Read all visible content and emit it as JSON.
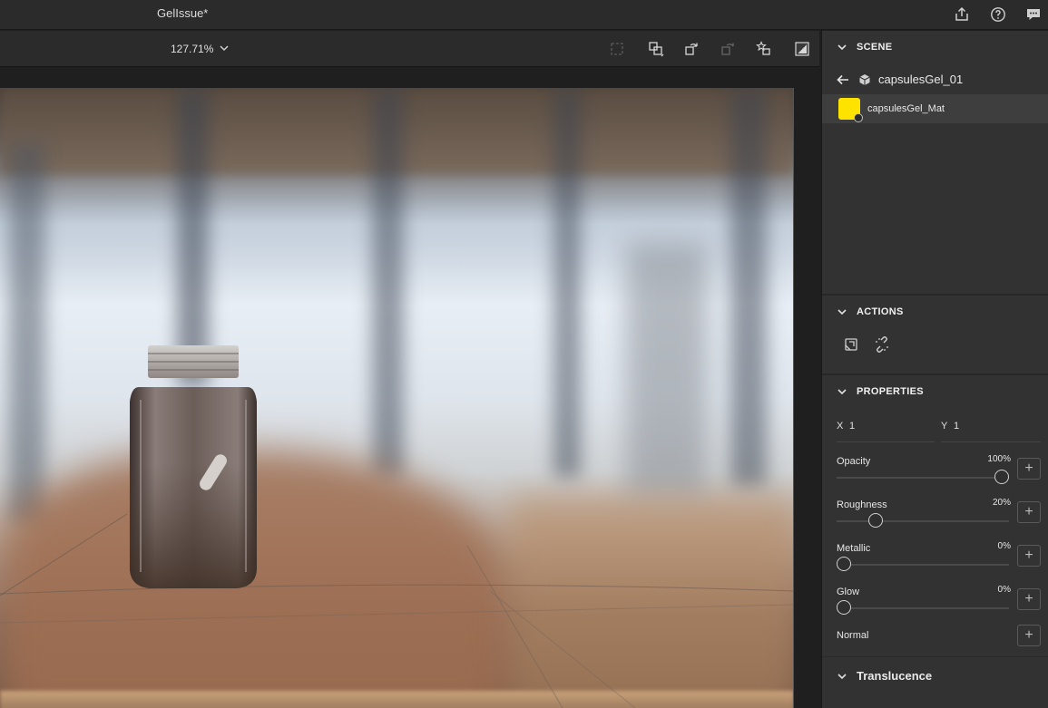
{
  "app": {
    "document_title": "GelIssue*",
    "title_icons": [
      "share-icon",
      "help-icon",
      "feedback-icon"
    ]
  },
  "viewport_toolbar": {
    "zoom": "127.71%",
    "icons": [
      "frame-icon",
      "fit-selection-icon",
      "rotate-icon",
      "redo-camera-icon",
      "favorite-camera-icon",
      "render-icon"
    ]
  },
  "scene": {
    "header": "SCENE",
    "object_name": "capsulesGel_01",
    "material_name": "capsulesGel_Mat",
    "material_color": "#ffe300"
  },
  "actions": {
    "header": "ACTIONS",
    "icons": [
      "replace-material-icon",
      "unlink-icon"
    ]
  },
  "properties": {
    "header": "PROPERTIES",
    "repeat": {
      "x_label": "X",
      "x_value": "1",
      "y_label": "Y",
      "y_value": "1"
    },
    "opacity": {
      "label": "Opacity",
      "value": "100%",
      "level": 1.0
    },
    "roughness": {
      "label": "Roughness",
      "value": "20%",
      "level": 0.2
    },
    "metallic": {
      "label": "Metallic",
      "value": "0%",
      "level": 0.0
    },
    "glow": {
      "label": "Glow",
      "value": "0%",
      "level": 0.0
    },
    "normal": {
      "label": "Normal"
    },
    "translucence": {
      "label": "Translucence"
    }
  }
}
